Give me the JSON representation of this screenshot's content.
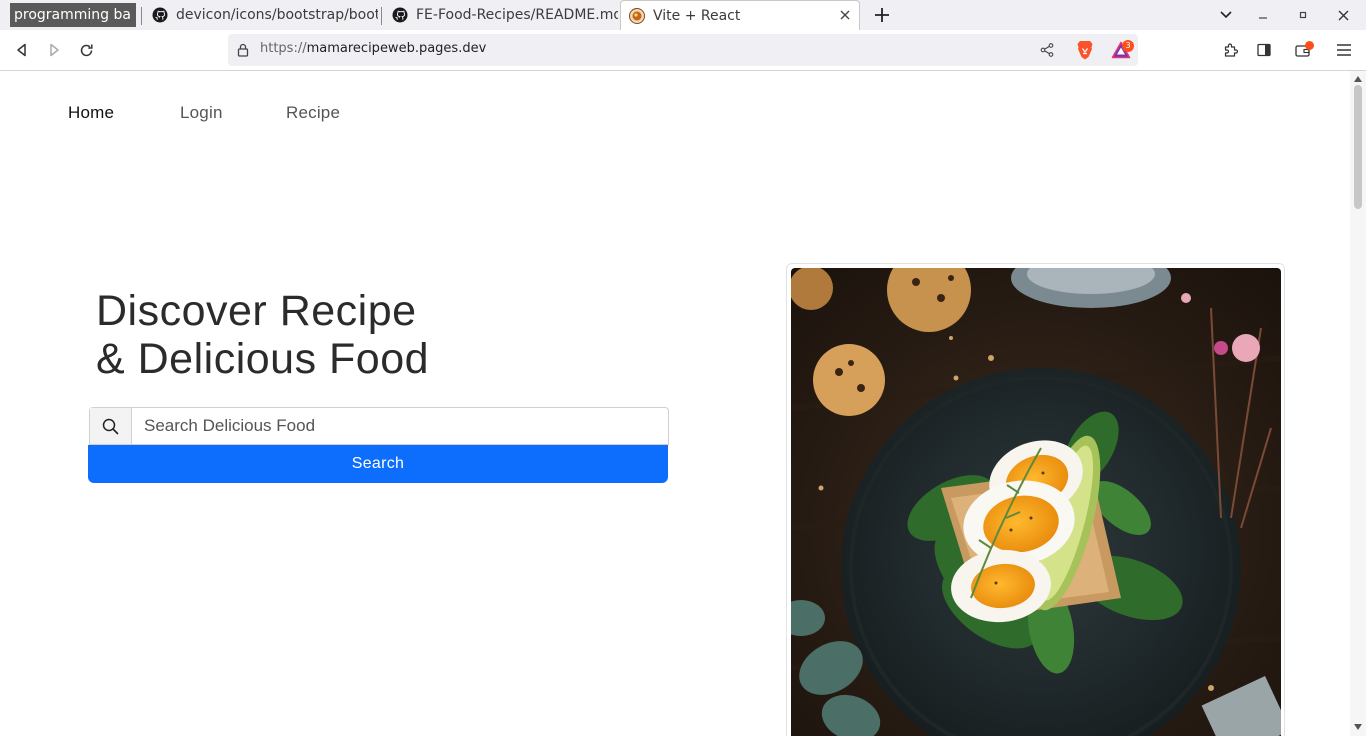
{
  "browser": {
    "tabs": [
      {
        "label": "programming ba",
        "kind": "group"
      },
      {
        "label": "devicon/icons/bootstrap/boot",
        "icon": "github-icon"
      },
      {
        "label": "FE-Food-Recipes/README.md",
        "icon": "github-icon"
      },
      {
        "label": "Vite + React",
        "icon": "recipe-favicon",
        "active": true
      }
    ],
    "url": {
      "scheme": "https://",
      "host": "mamarecipeweb.pages.dev"
    },
    "notification_count": "3",
    "accent_color": "#ff4d1a"
  },
  "nav": {
    "links": [
      {
        "label": "Home",
        "active": true
      },
      {
        "label": "Login",
        "active": false
      },
      {
        "label": "Recipe",
        "active": false
      }
    ]
  },
  "hero": {
    "title_line1": "Discover Recipe",
    "title_line2": "& Delicious Food",
    "search": {
      "placeholder": "Search Delicious Food",
      "value": ""
    },
    "search_button_label": "Search",
    "button_color": "#0d6efd"
  },
  "photo": {
    "subject": "egg-avocado-toast-image"
  }
}
